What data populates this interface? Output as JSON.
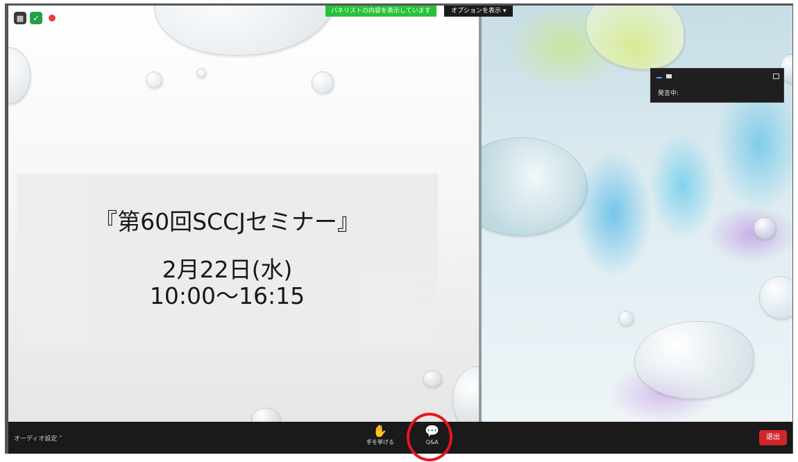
{
  "banner": {
    "panelist_notice": "パネリストの内容を表示しています",
    "view_options": "オプションを表示 ▾"
  },
  "slide": {
    "title": "『第60回SCCJセミナー』",
    "date": "2月22日(水)",
    "time": "10:00〜16:15"
  },
  "mini_window": {
    "speaker_label": "発言中:"
  },
  "toolbar": {
    "audio_settings": "オーディオ設定 ˄",
    "raise_hand": "手を挙げる",
    "qa": "Q&A",
    "leave": "退出"
  },
  "colors": {
    "panelist_banner": "#27c239",
    "toolbar_bg": "#1a1a1a",
    "leave_button": "#d0262a",
    "highlight_ring": "#e8141b"
  },
  "icons": {
    "grid": "grid-icon",
    "shield": "shield-icon",
    "record": "record-icon",
    "raise_hand": "hand-icon",
    "qa": "speech-bubbles-icon"
  }
}
